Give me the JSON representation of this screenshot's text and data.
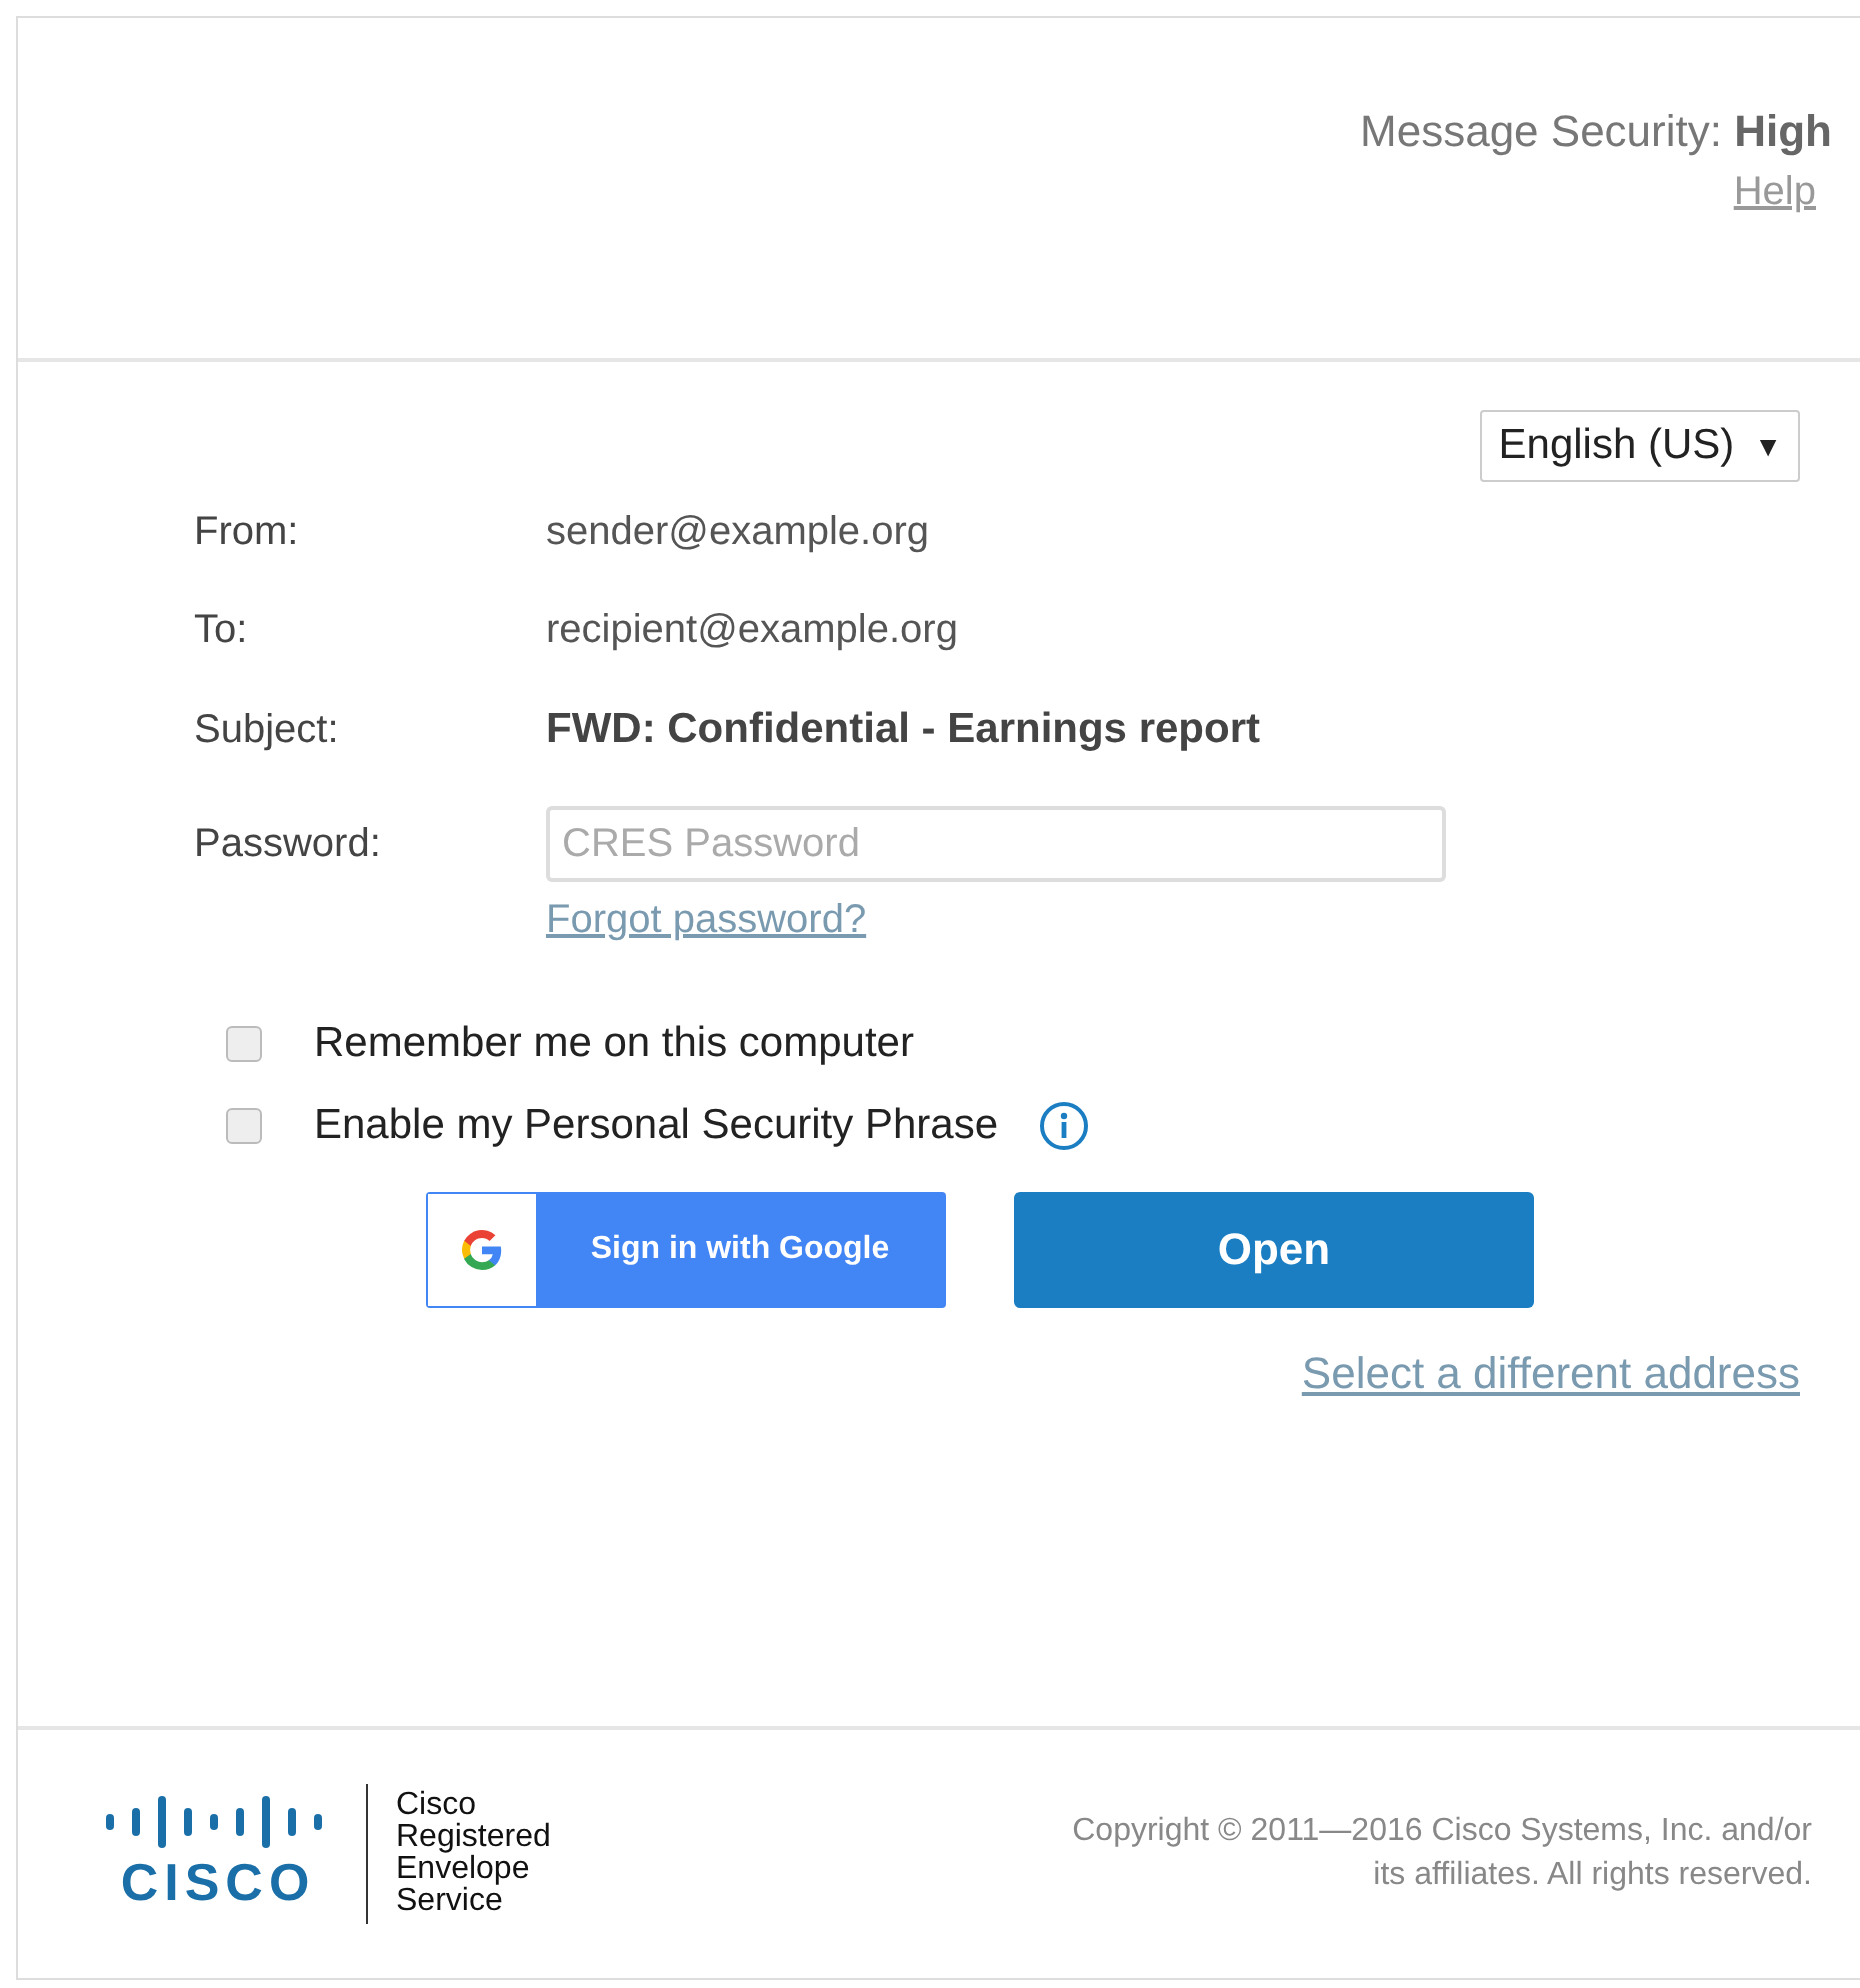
{
  "header": {
    "security_label": "Message Security:",
    "security_level": "High",
    "help_link": "Help"
  },
  "language_select": {
    "value": "English (US)",
    "caret": "▼"
  },
  "fields": [
    {
      "label": "From:",
      "value": "sender@example.org",
      "kind": "text"
    },
    {
      "label": "To:",
      "value": "recipient@example.org",
      "kind": "text"
    },
    {
      "label": "Subject:",
      "value": "FWD: Confidential - Earnings report",
      "kind": "bold"
    }
  ],
  "password": {
    "label": "Password:",
    "placeholder": "CRES Password",
    "forgot_link": "Forgot password?"
  },
  "options": [
    {
      "label": "Remember me on this computer",
      "checked": false,
      "info": false
    },
    {
      "label": "Enable my Personal Security Phrase",
      "checked": false,
      "info": true
    }
  ],
  "buttons": {
    "google": "Sign in with Google",
    "open": "Open"
  },
  "select_address_link": "Select a different address",
  "footer": {
    "logo_word": "CISCO",
    "service_name": [
      "Cisco",
      "Registered",
      "Envelope",
      "Service"
    ],
    "copyright": [
      "Copyright © 2011—2016 Cisco Systems, Inc. and/or",
      "its affiliates. All rights reserved."
    ]
  }
}
